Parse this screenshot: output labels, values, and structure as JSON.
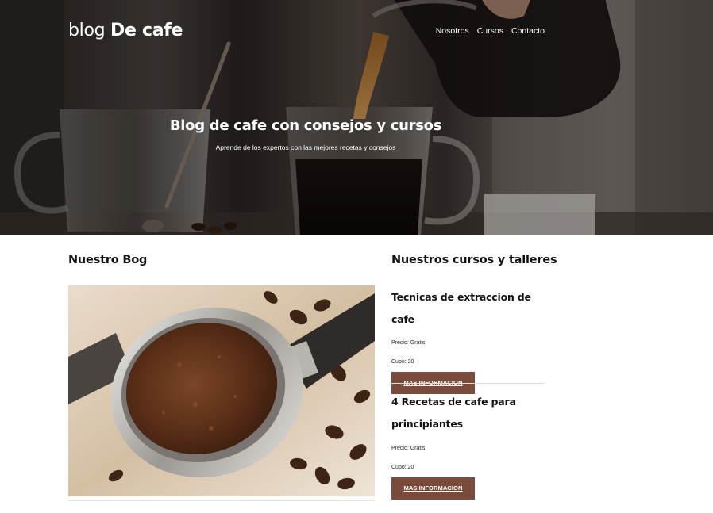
{
  "header": {
    "logo_light": "blog",
    "logo_bold": "De cafe",
    "nav": [
      "Nosotros",
      "Cursos",
      "Contacto"
    ]
  },
  "hero": {
    "title": "Blog de cafe con consejos y cursos",
    "subtitle": "Aprende de los expertos con las mejores recetas y consejos"
  },
  "blog": {
    "heading": "Nuestro Bog"
  },
  "courses": {
    "heading": "Nuestros cursos y talleres",
    "items": [
      {
        "title": "Tecnicas de extraccion de cafe",
        "price": "Precio: Gratis",
        "capacity": "Cupo: 20",
        "button": "MAS INFORMACION"
      },
      {
        "title": "4 Recetas de cafe para principiantes",
        "price": "Precio: Gratis",
        "capacity": "Cupo: 20",
        "button": "MAS INFORMACION"
      }
    ]
  },
  "colors": {
    "button_bg": "#7a4b3a",
    "text": "#111111",
    "hero_overlay": "rgba(0,0,0,0.28)"
  }
}
